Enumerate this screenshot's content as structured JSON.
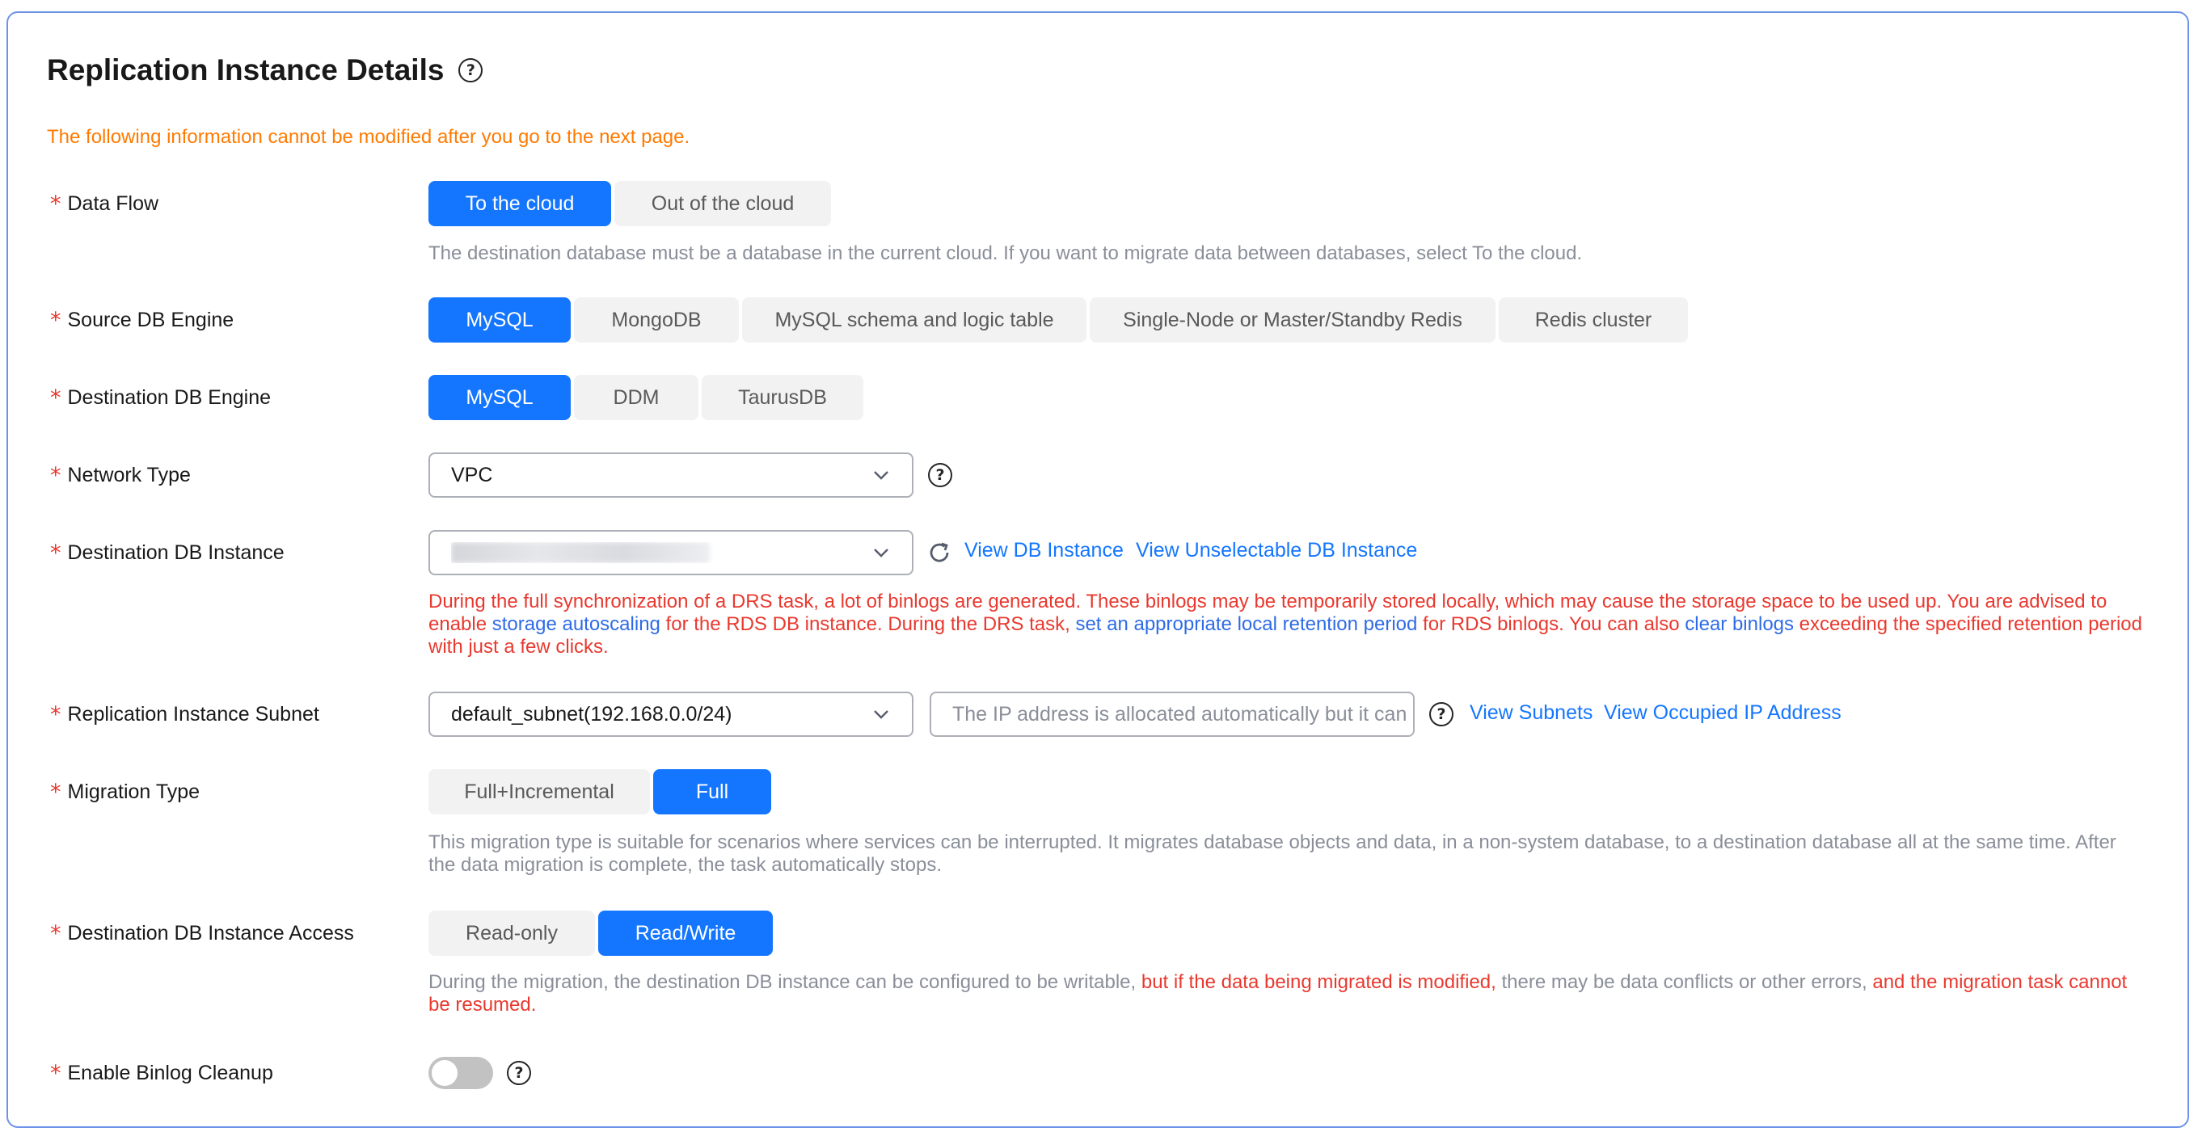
{
  "header": {
    "title": "Replication Instance Details",
    "warning": "The following information cannot be modified after you go to the next page."
  },
  "data_flow": {
    "label": "Data Flow",
    "options": [
      "To the cloud",
      "Out of the cloud"
    ],
    "selected": "To the cloud",
    "hint": "The destination database must be a database in the current cloud. If you want to migrate data between databases, select To the cloud."
  },
  "source_engine": {
    "label": "Source DB Engine",
    "options": [
      "MySQL",
      "MongoDB",
      "MySQL schema and logic table",
      "Single-Node or Master/Standby Redis",
      "Redis cluster"
    ],
    "selected": "MySQL"
  },
  "dest_engine": {
    "label": "Destination DB Engine",
    "options": [
      "MySQL",
      "DDM",
      "TaurusDB"
    ],
    "selected": "MySQL"
  },
  "network_type": {
    "label": "Network Type",
    "value": "VPC"
  },
  "dest_instance": {
    "label": "Destination DB Instance",
    "view_link": "View DB Instance",
    "unselectable_link": "View Unselectable DB Instance",
    "warning": {
      "p1": "During the full synchronization of a DRS task, a lot of binlogs are generated. These binlogs may be temporarily stored locally, which may cause the storage space to be used up. You are advised to enable ",
      "link1": "storage autoscaling",
      "p2": " for the RDS DB instance. During the DRS task, ",
      "link2": "set an appropriate local retention period",
      "p3": " for RDS binlogs. You can also ",
      "link3": "clear binlogs",
      "p4": " exceeding the specified retention period with just a few clicks."
    }
  },
  "subnet": {
    "label": "Replication Instance Subnet",
    "value": "default_subnet(192.168.0.0/24)",
    "ip_placeholder": "The IP address is allocated automatically but it can",
    "view_subnets": "View Subnets",
    "view_occupied": "View Occupied IP Address"
  },
  "migration_type": {
    "label": "Migration Type",
    "options": [
      "Full+Incremental",
      "Full"
    ],
    "selected": "Full",
    "hint": "This migration type is suitable for scenarios where services can be interrupted. It migrates database objects and data, in a non-system database, to a destination database all at the same time. After the data migration is complete, the task automatically stops."
  },
  "access": {
    "label": "Destination DB Instance Access",
    "options": [
      "Read-only",
      "Read/Write"
    ],
    "selected": "Read/Write",
    "hint": {
      "p1": "During the migration, the destination DB instance can be configured to be writable, ",
      "r1": "but if the data being migrated is modified,",
      "p2": " there may be data conflicts or other errors, ",
      "r2": "and the migration task cannot be resumed."
    }
  },
  "binlog_cleanup": {
    "label": "Enable Binlog Cleanup",
    "enabled": false
  },
  "colors": {
    "primary": "#1476ff",
    "warning": "#ff7a00",
    "error": "#e8392f",
    "hint": "#8a8e99"
  }
}
